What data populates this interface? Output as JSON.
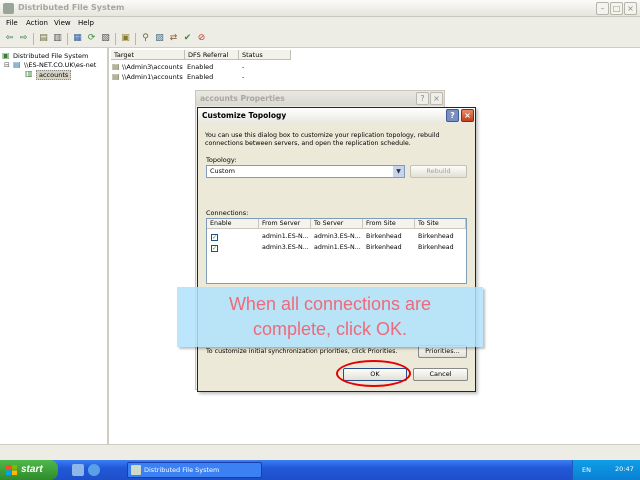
{
  "window": {
    "title": "Distributed File System"
  },
  "menu": [
    "File",
    "Action",
    "View",
    "Help"
  ],
  "tree": {
    "root": "Distributed File System",
    "domain": "\\\\ES-NET.CO.UK\\es-net",
    "leaf": "accounts"
  },
  "list": {
    "headers": [
      "Target",
      "DFS Referral",
      "Status"
    ],
    "rows": [
      {
        "target": "\\\\Admin3\\accounts",
        "referral": "Enabled",
        "status": "-"
      },
      {
        "target": "\\\\Admin1\\accounts",
        "referral": "Enabled",
        "status": "-"
      }
    ]
  },
  "props_dialog": {
    "title": "accounts Properties"
  },
  "dialog": {
    "title": "Customize Topology",
    "description": "You can use this dialog box to customize your replication topology, rebuild connections between servers, and open the replication schedule.",
    "topology_label": "Topology:",
    "topology_value": "Custom",
    "rebuild_label": "Rebuild",
    "connections_label": "Connections:",
    "columns": [
      "Enable",
      "From Server",
      "To Server",
      "From Site",
      "To Site"
    ],
    "rows": [
      {
        "enabled": "✓",
        "from_server": "admin1.ES-N...",
        "to_server": "admin3.ES-N...",
        "from_site": "Birkenhead",
        "to_site": "Birkenhead"
      },
      {
        "enabled": "✓",
        "from_server": "admin3.ES-N...",
        "to_server": "admin1.ES-N...",
        "from_site": "Birkenhead",
        "to_site": "Birkenhead"
      }
    ],
    "priorities_text": "To customize initial synchronization priorities, click Priorities.",
    "priorities_label": "Priorities...",
    "ok_label": "OK",
    "cancel_label": "Cancel"
  },
  "overlay": {
    "line1": "When all connections are",
    "line2": "complete, click OK."
  },
  "taskbar": {
    "start_label": "start",
    "task_label": "Distributed File System",
    "lang": "EN",
    "clock": "20:47"
  },
  "colors": {
    "overlay_bg": "#b0e2fc",
    "overlay_text": "#ee6a7a",
    "highlight_ring": "#e60000",
    "taskbar": "#2058d8"
  }
}
